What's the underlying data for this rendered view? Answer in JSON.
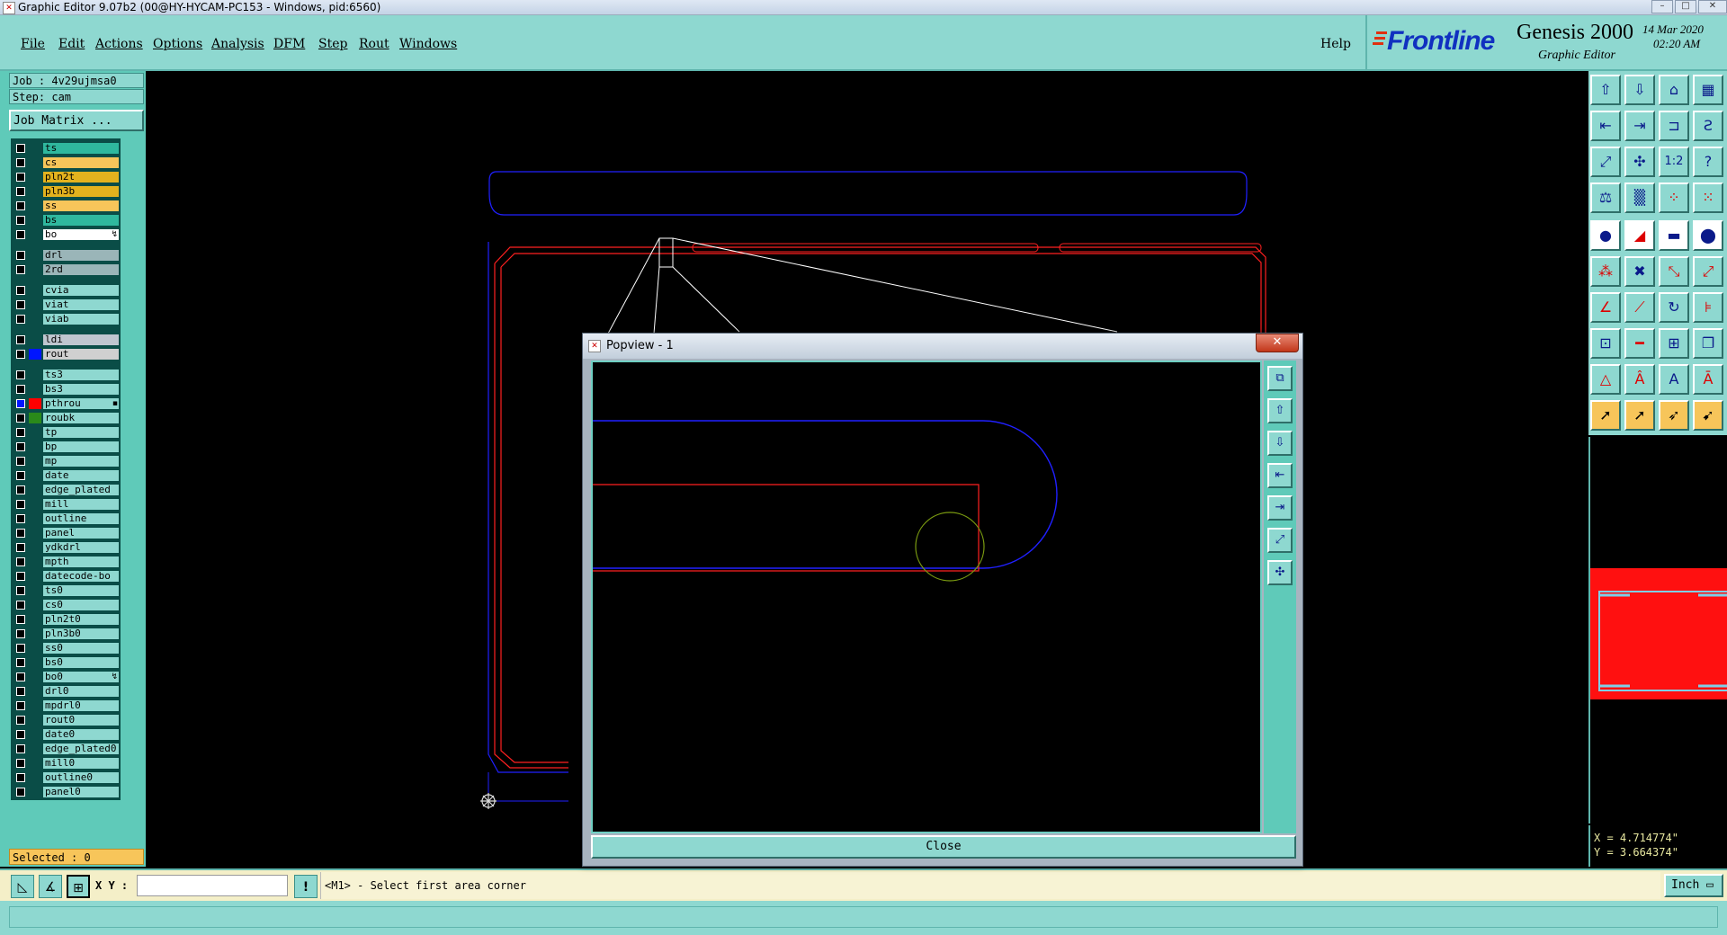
{
  "window": {
    "title": "Graphic Editor 9.07b2 (00@HY-HYCAM-PC153 - Windows, pid:6560)",
    "min_label": "–",
    "max_label": "□",
    "close_label": "✕"
  },
  "menu": {
    "items": [
      "File",
      "Edit",
      "Actions",
      "Options",
      "Analysis",
      "DFM",
      "Step",
      "Rout",
      "Windows"
    ],
    "help": "Help"
  },
  "brand": {
    "logo": "Frontline",
    "product": "Genesis 2000",
    "subtitle": "Graphic Editor",
    "date": "14 Mar 2020",
    "time": "02:20 AM"
  },
  "job": {
    "job_label": "Job : 4v29ujmsa0",
    "step_label": "Step: cam",
    "matrix_button": "Job Matrix ..."
  },
  "layers": [
    {
      "name": "ts",
      "color": "#2fb89e",
      "group": 0
    },
    {
      "name": "cs",
      "color": "#f7c55a",
      "group": 0
    },
    {
      "name": "pln2t",
      "color": "#e3b21e",
      "group": 0
    },
    {
      "name": "pln3b",
      "color": "#e3b21e",
      "group": 0
    },
    {
      "name": "ss",
      "color": "#f7c55a",
      "group": 0
    },
    {
      "name": "bs",
      "color": "#2fb89e",
      "group": 0
    },
    {
      "name": "bo",
      "color": "#ffffff",
      "group": 0,
      "mark": "↯"
    },
    {
      "name": "drl",
      "color": "#9ab5b8",
      "group": 1
    },
    {
      "name": "2rd",
      "color": "#9ab5b8",
      "group": 1
    },
    {
      "name": "cvia",
      "color": "#8ed8d0",
      "group": 2
    },
    {
      "name": "viat",
      "color": "#8ed8d0",
      "group": 2
    },
    {
      "name": "viab",
      "color": "#8ed8d0",
      "group": 2
    },
    {
      "name": "ldi",
      "color": "#bfc6cf",
      "group": 3
    },
    {
      "name": "rout",
      "color": "#d0d0d0",
      "group": 3,
      "swatch": "#0015ff"
    },
    {
      "name": "ts3",
      "color": "#8ed8d0",
      "group": 4
    },
    {
      "name": "bs3",
      "color": "#8ed8d0",
      "group": 4
    },
    {
      "name": "pthrou",
      "color": "#8ed8d0",
      "group": 4,
      "swatch": "#ff0000",
      "cb_blue": true,
      "mark": "▪"
    },
    {
      "name": "roubk",
      "color": "#8ed8d0",
      "group": 4,
      "swatch": "#2a8a1a"
    },
    {
      "name": "tp",
      "color": "#8ed8d0",
      "group": 4
    },
    {
      "name": "bp",
      "color": "#8ed8d0",
      "group": 4
    },
    {
      "name": "mp",
      "color": "#8ed8d0",
      "group": 4
    },
    {
      "name": "date",
      "color": "#8ed8d0",
      "group": 4
    },
    {
      "name": "edge_plated",
      "color": "#8ed8d0",
      "group": 4
    },
    {
      "name": "mill",
      "color": "#8ed8d0",
      "group": 4
    },
    {
      "name": "outline",
      "color": "#8ed8d0",
      "group": 4
    },
    {
      "name": "panel",
      "color": "#8ed8d0",
      "group": 4
    },
    {
      "name": "ydkdrl",
      "color": "#8ed8d0",
      "group": 4
    },
    {
      "name": "mpth",
      "color": "#8ed8d0",
      "group": 4
    },
    {
      "name": "datecode-bo",
      "color": "#8ed8d0",
      "group": 4
    },
    {
      "name": "ts0",
      "color": "#8ed8d0",
      "group": 4
    },
    {
      "name": "cs0",
      "color": "#8ed8d0",
      "group": 4
    },
    {
      "name": "pln2t0",
      "color": "#8ed8d0",
      "group": 4
    },
    {
      "name": "pln3b0",
      "color": "#8ed8d0",
      "group": 4
    },
    {
      "name": "ss0",
      "color": "#8ed8d0",
      "group": 4
    },
    {
      "name": "bs0",
      "color": "#8ed8d0",
      "group": 4
    },
    {
      "name": "bo0",
      "color": "#8ed8d0",
      "group": 4,
      "mark": "↯"
    },
    {
      "name": "drl0",
      "color": "#8ed8d0",
      "group": 4
    },
    {
      "name": "mpdrl0",
      "color": "#8ed8d0",
      "group": 4
    },
    {
      "name": "rout0",
      "color": "#8ed8d0",
      "group": 4
    },
    {
      "name": "date0",
      "color": "#8ed8d0",
      "group": 4
    },
    {
      "name": "edge_plated0",
      "color": "#8ed8d0",
      "group": 4
    },
    {
      "name": "mill0",
      "color": "#8ed8d0",
      "group": 4
    },
    {
      "name": "outline0",
      "color": "#8ed8d0",
      "group": 4
    },
    {
      "name": "panel0",
      "color": "#8ed8d0",
      "group": 4
    }
  ],
  "selected_label": "Selected : 0",
  "coords": {
    "x": "X = 4.714774\"",
    "y": "Y = 3.664374\""
  },
  "bottom": {
    "xy_label": "X Y :",
    "xy_value": "",
    "warn_icon": "!",
    "message": "<M1> - Select first area corner",
    "units": "Inch"
  },
  "popview": {
    "title": "Popview - 1",
    "close_x": "✕",
    "close_button": "Close"
  },
  "colors": {
    "panel": "#8ed8d0",
    "rout": "#2020ff",
    "pthrou": "#ff2020",
    "accent_yellow": "#f7c55a"
  }
}
